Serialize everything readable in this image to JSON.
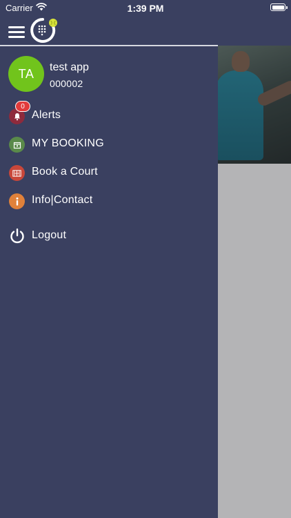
{
  "status_bar": {
    "carrier": "Carrier",
    "time": "1:39 PM"
  },
  "user": {
    "initials": "TA",
    "name": "test app",
    "id": "000002",
    "avatar_color": "#71c41c"
  },
  "menu": {
    "alerts": {
      "label": "Alerts",
      "badge": "0",
      "icon": "bell-icon",
      "color": "#b8313a"
    },
    "my_booking": {
      "label": "MY BOOKING",
      "icon": "calendar-icon",
      "color": "#5a8a4a"
    },
    "book_court": {
      "label": "Book a Court",
      "icon": "court-icon",
      "color": "#c9473a"
    },
    "info_contact": {
      "label": "Info|Contact",
      "icon": "info-icon",
      "color": "#e0813a"
    },
    "logout": {
      "label": "Logout",
      "icon": "power-icon"
    }
  },
  "colors": {
    "drawer_bg": "#3a4060",
    "content_bg": "#b4b4b6"
  }
}
